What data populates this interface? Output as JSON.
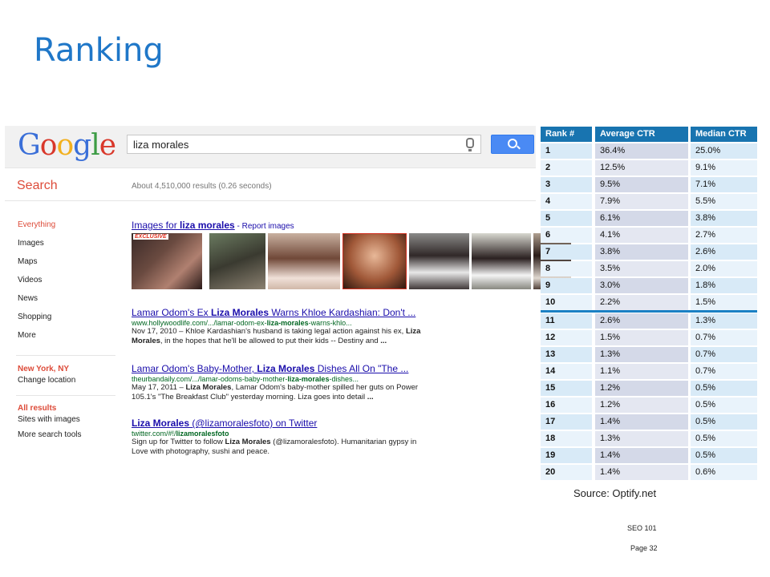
{
  "slide": {
    "title": "Ranking",
    "source": "Source: Optify.net",
    "footer_course": "SEO 101",
    "footer_page": "Page 32"
  },
  "google": {
    "logo_letters": [
      {
        "ch": "G",
        "color": "#3a6fd8"
      },
      {
        "ch": "o",
        "color": "#d9382b"
      },
      {
        "ch": "o",
        "color": "#f2b01e"
      },
      {
        "ch": "g",
        "color": "#3a6fd8"
      },
      {
        "ch": "l",
        "color": "#3d9c45"
      },
      {
        "ch": "e",
        "color": "#d9382b"
      }
    ],
    "query": "liza morales",
    "search_label": "Search",
    "stats": "About 4,510,000 results (0.26 seconds)",
    "nav": [
      "Everything",
      "Images",
      "Maps",
      "Videos",
      "News",
      "Shopping",
      "More"
    ],
    "location": {
      "name": "New York, NY",
      "change": "Change location"
    },
    "filters": [
      "All results",
      "Sites with images",
      "More search tools"
    ],
    "images_header": {
      "prefix": "Images for ",
      "query": "liza morales",
      "report": " - Report images"
    },
    "results": [
      {
        "title_a": "Lamar Odom's Ex ",
        "title_b": "Liza Morales",
        "title_c": " Warns Khloe Kardashian: Don't ...",
        "url_a": "www.hollywoodlife.com/.../lamar-odom-ex-",
        "url_b": "liza-morales",
        "url_c": "-warns-khlo...",
        "snip_1a": "Nov 17, 2010 – Khloe Kardashian's husband is taking legal action against his ex, ",
        "snip_1b": "Liza",
        "snip_2a": "Morales",
        "snip_2b": ", in the hopes that he'll be allowed to put their kids -- Destiny and ",
        "snip_2c": "..."
      },
      {
        "title_a": "Lamar Odom's Baby-Mother, ",
        "title_b": "Liza Morales",
        "title_c": " Dishes All On \"The ...",
        "url_a": "theurbandaily.com/.../lamar-odoms-baby-mother-",
        "url_b": "liza-morales",
        "url_c": "-dishes...",
        "snip_1a": "May 17, 2011 – ",
        "snip_1b": "Liza Morales",
        "snip_1c": ", Lamar Odom's baby-mother spilled her guts on Power",
        "snip_2a": "105.1's \"The Breakfast Club\" yesterday morning. Liza goes into detail ",
        "snip_2b": "..."
      },
      {
        "title_a": "",
        "title_b": "Liza Morales",
        "title_c": " (@lizamoralesfoto) on Twitter",
        "url_a": "twitter.com/#!/",
        "url_b": "lizamoralesfoto",
        "url_c": "",
        "snip_1a": "Sign up for Twitter to follow ",
        "snip_1b": "Liza Morales",
        "snip_1c": " (@lizamoralesfoto). Humanitarian gypsy in",
        "snip_2a": "Love with photography, sushi and peace."
      }
    ],
    "thumb_label": "EXCLUSIVE"
  },
  "ctr_table": {
    "headers": [
      "Rank #",
      "Average CTR",
      "Median CTR"
    ],
    "rows": [
      [
        "1",
        "36.4%",
        "25.0%"
      ],
      [
        "2",
        "12.5%",
        "9.1%"
      ],
      [
        "3",
        "9.5%",
        "7.1%"
      ],
      [
        "4",
        "7.9%",
        "5.5%"
      ],
      [
        "5",
        "6.1%",
        "3.8%"
      ],
      [
        "6",
        "4.1%",
        "2.7%"
      ],
      [
        "7",
        "3.8%",
        "2.6%"
      ],
      [
        "8",
        "3.5%",
        "2.0%"
      ],
      [
        "9",
        "3.0%",
        "1.8%"
      ],
      [
        "10",
        "2.2%",
        "1.5%"
      ],
      [
        "11",
        "2.6%",
        "1.3%"
      ],
      [
        "12",
        "1.5%",
        "0.7%"
      ],
      [
        "13",
        "1.3%",
        "0.7%"
      ],
      [
        "14",
        "1.1%",
        "0.7%"
      ],
      [
        "15",
        "1.2%",
        "0.5%"
      ],
      [
        "16",
        "1.2%",
        "0.5%"
      ],
      [
        "17",
        "1.4%",
        "0.5%"
      ],
      [
        "18",
        "1.3%",
        "0.5%"
      ],
      [
        "19",
        "1.4%",
        "0.5%"
      ],
      [
        "20",
        "1.4%",
        "0.6%"
      ]
    ]
  }
}
